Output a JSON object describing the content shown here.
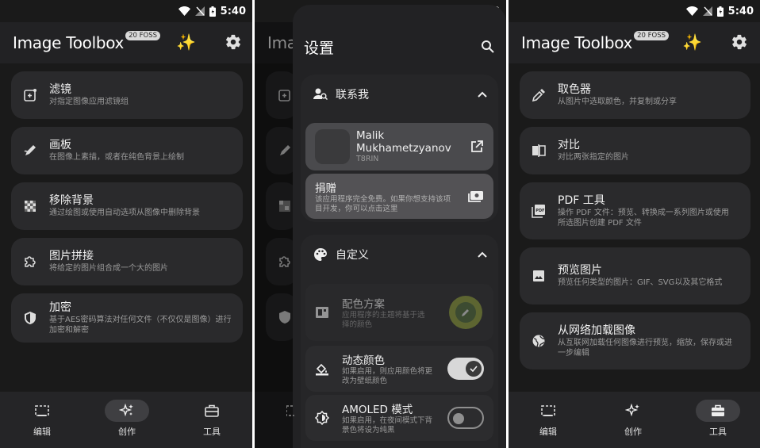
{
  "status": {
    "time": "5:40"
  },
  "app": {
    "title": "Image Toolbox",
    "badge": "20 FOSS"
  },
  "panel1": {
    "items": [
      {
        "icon": "filter-icon",
        "title": "滤镜",
        "desc": "对指定图像应用滤镜组"
      },
      {
        "icon": "draw-icon",
        "title": "画板",
        "desc": "在图像上素描，或者在纯色背景上绘制"
      },
      {
        "icon": "eraser-icon",
        "title": "移除背景",
        "desc": "通过绘图或使用自动选项从图像中删除背景"
      },
      {
        "icon": "puzzle-icon",
        "title": "图片拼接",
        "desc": "将给定的图片组合成一个大的图片"
      },
      {
        "icon": "shield-icon",
        "title": "加密",
        "desc": "基于AES密码算法对任何文件（不仅仅是图像）进行加密和解密"
      }
    ]
  },
  "nav": [
    {
      "label": "编辑",
      "icon": "edit-crop-icon"
    },
    {
      "label": "创作",
      "icon": "sparkle-create-icon"
    },
    {
      "label": "工具",
      "icon": "toolbox-icon"
    }
  ],
  "settings": {
    "title": "设置",
    "contact": {
      "header": "联系我",
      "author_name": "Malik Mukhametzyanov",
      "author_handle": "T8RIN",
      "donate_title": "捐赠",
      "donate_desc": "该应用程序完全免费。如果你想支持该项目开发，你可以点击这里"
    },
    "customize": {
      "header": "自定义",
      "color_scheme_title": "配色方案",
      "color_scheme_desc": "应用程序的主题将基于选择的颜色",
      "dynamic_title": "动态颜色",
      "dynamic_desc": "如果启用，则应用颜色将更改为壁纸颜色",
      "dynamic_on": true,
      "amoled_title": "AMOLED 模式",
      "amoled_desc": "如果启用，在夜间模式下背景色将设为纯黑",
      "amoled_on": false
    },
    "bg_letters": "Ima"
  },
  "panel3": {
    "items": [
      {
        "icon": "color-picker-icon",
        "title": "取色器",
        "desc": "从图片中选取颜色，并复制或分享"
      },
      {
        "icon": "compare-icon",
        "title": "对比",
        "desc": "对比两张指定的图片"
      },
      {
        "icon": "pdf-icon",
        "title": "PDF 工具",
        "desc": "操作 PDF 文件：预览、转换成一系列图片或使用所选图片创建 PDF 文件"
      },
      {
        "icon": "image-icon",
        "title": "预览图片",
        "desc": "预览任何类型的图片：GIF、SVG以及其它格式"
      },
      {
        "icon": "globe-icon",
        "title": "从网络加载图像",
        "desc": "从互联网加载任何图像进行预览，缩放，保存或进一步编辑"
      }
    ]
  },
  "colors": {
    "background": "#1a1a1a",
    "card": "#2a2a2c",
    "accent_yellow": "#ffd54a",
    "switch_on": "#d8d8d8",
    "color_ring": "#8a9a3a"
  }
}
